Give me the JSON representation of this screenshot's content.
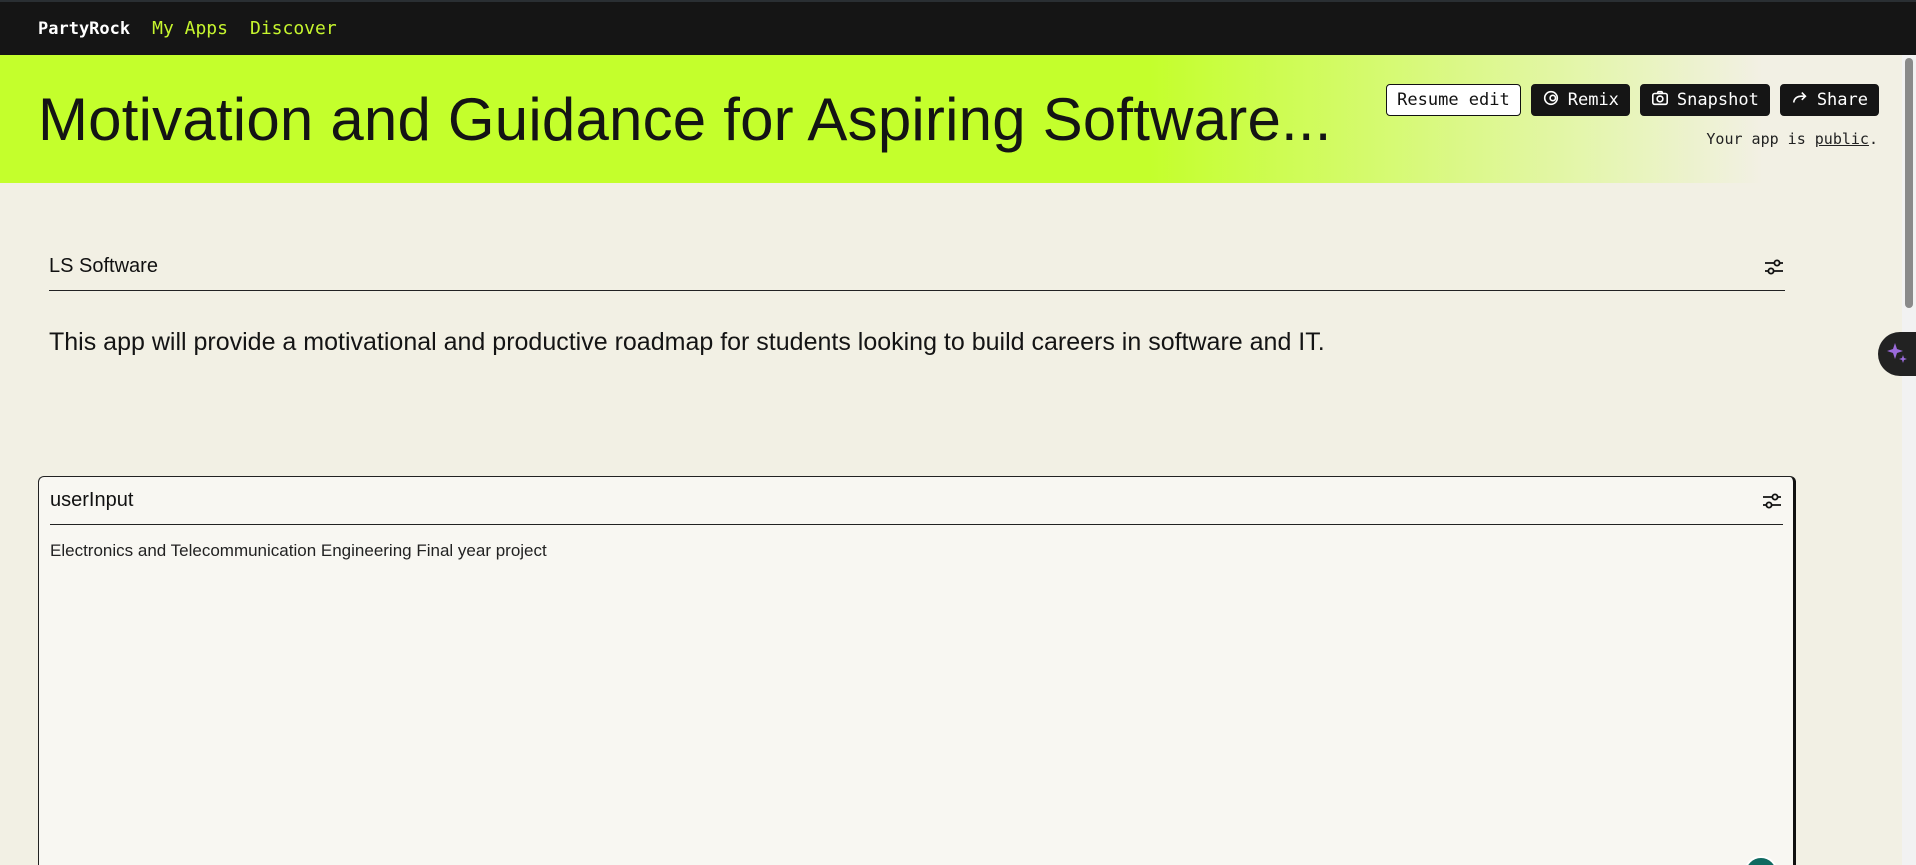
{
  "nav": {
    "brand": "PartyRock",
    "links": [
      "My Apps",
      "Discover"
    ]
  },
  "hero": {
    "title": "Motivation and Guidance for Aspiring Software...",
    "buttons": {
      "resume_edit": "Resume edit",
      "remix": "Remix",
      "snapshot": "Snapshot",
      "share": "Share"
    },
    "visibility_prefix": "Your app is",
    "visibility_value": "public",
    "visibility_suffix": "."
  },
  "widgets": [
    {
      "title": "LS Software",
      "body": "This app will provide a motivational and productive roadmap for students looking to build careers in software and IT."
    },
    {
      "title": "userInput",
      "body": "Electronics and Telecommunication Engineering Final year project"
    }
  ],
  "colors": {
    "accent": "#c4ff2c",
    "nav_bg": "#151515",
    "nav_link": "#c6f52e",
    "page_bg": "#f2f0e4",
    "sparkle": "#9b6bdc"
  },
  "icons": [
    "remix-icon",
    "camera-icon",
    "share-arrow-icon",
    "settings-sliders-icon",
    "sparkle-icon"
  ]
}
